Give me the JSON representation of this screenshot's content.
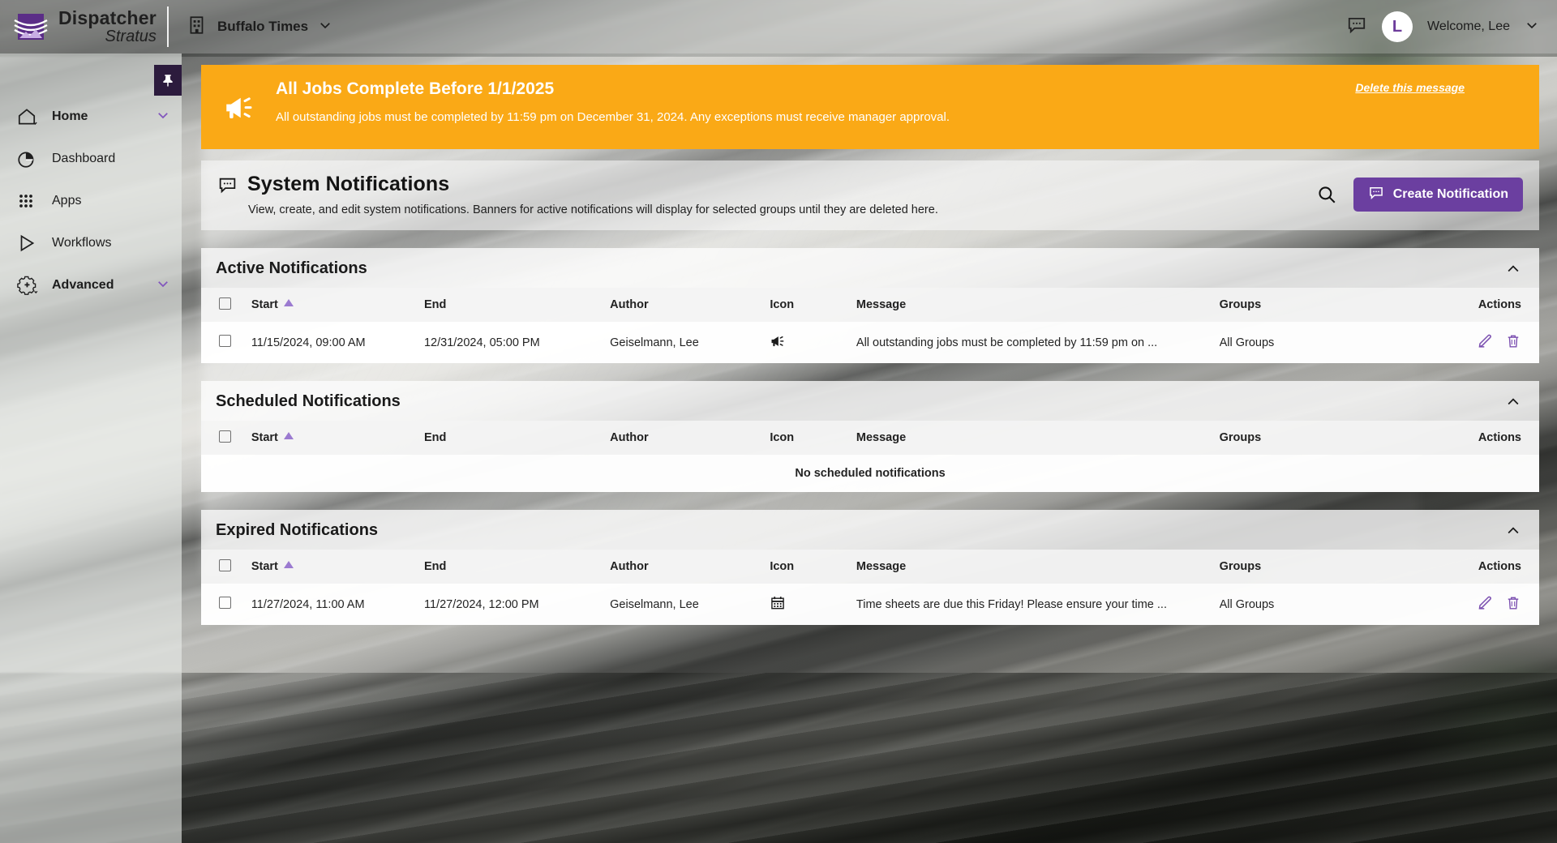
{
  "topbar": {
    "brand_line1": "Dispatcher",
    "brand_line2": "Stratus",
    "org_name": "Buffalo Times",
    "avatar_initial": "L",
    "welcome": "Welcome, Lee"
  },
  "sidebar": {
    "items": [
      {
        "label": "Home",
        "icon": "home-icon",
        "expandable": true
      },
      {
        "label": "Dashboard",
        "icon": "pie-chart-icon",
        "expandable": false
      },
      {
        "label": "Apps",
        "icon": "grid-dots-icon",
        "expandable": false
      },
      {
        "label": "Workflows",
        "icon": "play-triangle-icon",
        "expandable": false
      },
      {
        "label": "Advanced",
        "icon": "gear-plus-icon",
        "expandable": true
      }
    ]
  },
  "banner": {
    "title": "All Jobs Complete Before 1/1/2025",
    "message": "All outstanding jobs must be completed by 11:59 pm on December 31, 2024. Any exceptions must receive manager approval.",
    "delete_link": "Delete this message",
    "icon": "megaphone-icon",
    "color": "#FAA916"
  },
  "page_header": {
    "icon": "notification-bubble-icon",
    "title": "System Notifications",
    "subtitle": "View, create, and edit system notifications. Banners for active notifications will display for selected groups until they are deleted here.",
    "search_icon": "search-icon",
    "create_button": "Create Notification",
    "accent_color": "#6B3FA0"
  },
  "columns": [
    "Start",
    "End",
    "Author",
    "Icon",
    "Message",
    "Groups",
    "Actions"
  ],
  "sections": [
    {
      "title": "Active Notifications",
      "collapsed": false,
      "empty_text": null,
      "rows": [
        {
          "start": "11/15/2024, 09:00 AM",
          "end": "12/31/2024, 05:00 PM",
          "author": "Geiselmann, Lee",
          "icon": "megaphone-icon",
          "message": "All outstanding jobs must be completed by 11:59 pm on ...",
          "groups": "All Groups"
        }
      ]
    },
    {
      "title": "Scheduled Notifications",
      "collapsed": false,
      "empty_text": "No scheduled notifications",
      "rows": []
    },
    {
      "title": "Expired Notifications",
      "collapsed": false,
      "empty_text": null,
      "rows": [
        {
          "start": "11/27/2024, 11:00 AM",
          "end": "11/27/2024, 12:00 PM",
          "author": "Geiselmann, Lee",
          "icon": "calendar-icon",
          "message": "Time sheets are due this Friday! Please ensure your time ...",
          "groups": "All Groups"
        }
      ]
    }
  ]
}
